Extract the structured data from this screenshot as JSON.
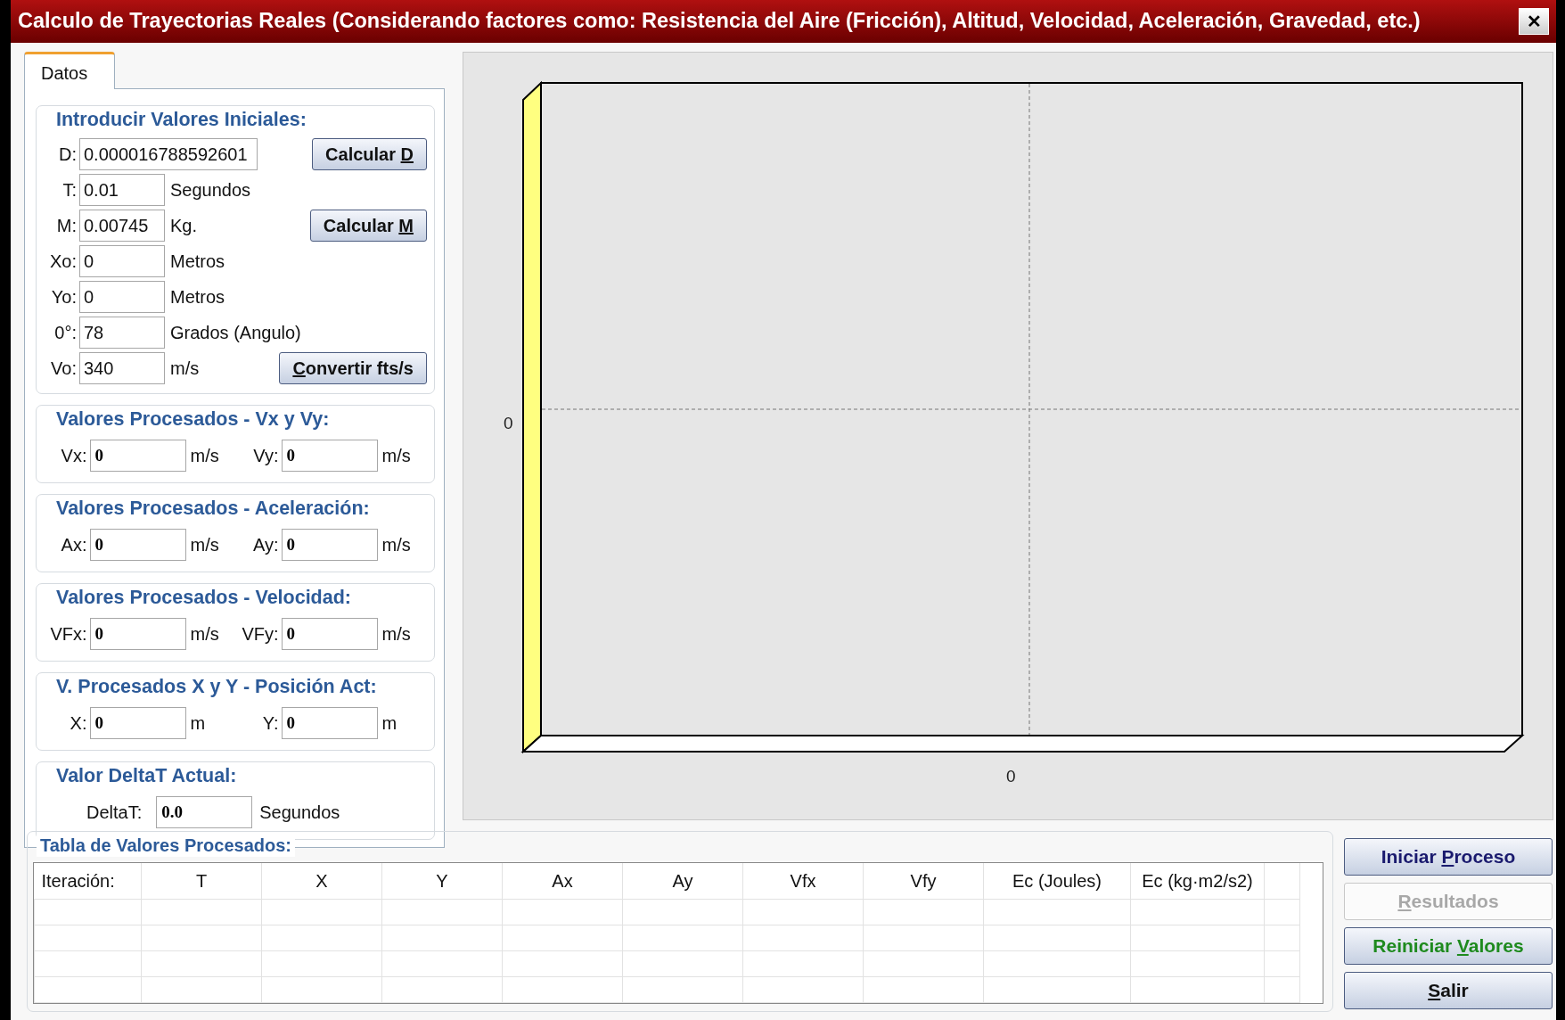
{
  "window": {
    "title": "Calculo de Trayectorias Reales (Considerando factores como: Resistencia del Aire (Fricción), Altitud, Velocidad, Aceleración, Gravedad, etc.)",
    "close": "✕"
  },
  "tabs": [
    {
      "label": "Datos",
      "selected": true
    }
  ],
  "initial_values": {
    "title": "Introducir Valores Iniciales:",
    "rows": [
      {
        "label": "D:",
        "value": "0.000016788592601",
        "button": {
          "pre": "Calcular ",
          "key": "D"
        }
      },
      {
        "label": "T:",
        "value": "0.01",
        "unit": "Segundos"
      },
      {
        "label": "M:",
        "value": "0.00745",
        "unit": "Kg.",
        "button": {
          "pre": "Calcular ",
          "key": "M"
        }
      },
      {
        "label": "Xo:",
        "value": "0",
        "unit": "Metros"
      },
      {
        "label": "Yo:",
        "value": "0",
        "unit": "Metros"
      },
      {
        "label": "0°:",
        "value": "78",
        "unit": "Grados (Angulo)"
      },
      {
        "label": "Vo:",
        "value": "340",
        "unit": "m/s",
        "button": {
          "key": "C",
          "post": "onvertir fts/s"
        }
      }
    ]
  },
  "processed_groups": [
    {
      "title": "Valores Procesados - Vx y Vy:",
      "fields": [
        {
          "label": "Vx:",
          "value": "0",
          "unit": "m/s"
        },
        {
          "label": "Vy:",
          "value": "0",
          "unit": "m/s"
        }
      ]
    },
    {
      "title": "Valores Procesados - Aceleración:",
      "fields": [
        {
          "label": "Ax:",
          "value": "0",
          "unit": "m/s"
        },
        {
          "label": "Ay:",
          "value": "0",
          "unit": "m/s"
        }
      ]
    },
    {
      "title": "Valores Procesados - Velocidad:",
      "fields": [
        {
          "label": "VFx:",
          "value": "0",
          "unit": "m/s"
        },
        {
          "label": "VFy:",
          "value": "0",
          "unit": "m/s"
        }
      ]
    },
    {
      "title": "V. Procesados X y Y - Posición Act:",
      "fields": [
        {
          "label": "X:",
          "value": "0",
          "unit": "m"
        },
        {
          "label": "Y:",
          "value": "0",
          "unit": "m"
        }
      ]
    }
  ],
  "delta": {
    "title": "Valor DeltaT Actual:",
    "label": "DeltaT:",
    "value": "0.0",
    "unit": "Segundos"
  },
  "chart": {
    "y_tick_label": "0",
    "x_tick_label": "0"
  },
  "table": {
    "title": "Tabla de Valores Procesados:",
    "columns": [
      "Iteración:",
      "T",
      "X",
      "Y",
      "Ax",
      "Ay",
      "Vfx",
      "Vfy",
      "Ec (Joules)",
      "Ec (kg·m2/s2)"
    ]
  },
  "buttons": [
    {
      "pre": "Iniciar ",
      "key": "P",
      "post": "roceso",
      "color": "#1a1a6e",
      "disabled": false
    },
    {
      "key": "R",
      "post": "esultados",
      "color": "#a8a8a8",
      "disabled": true
    },
    {
      "pre": "Reiniciar ",
      "key": "V",
      "post": "alores",
      "color": "#1e8a1e",
      "disabled": false
    },
    {
      "key": "S",
      "post": "alir",
      "color": "#111111",
      "disabled": false
    }
  ]
}
